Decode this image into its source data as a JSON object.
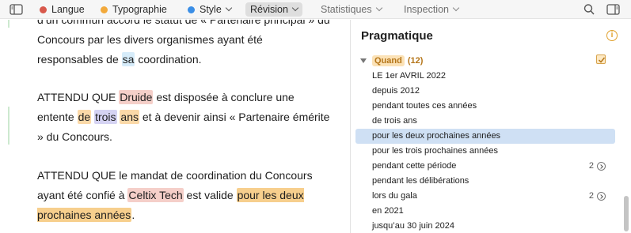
{
  "toolbar": {
    "items": [
      {
        "label": "Langue",
        "color": "#d8584b"
      },
      {
        "label": "Typographie",
        "color": "#f2a93b"
      },
      {
        "label": "Style",
        "color": "#3a8ee6"
      }
    ],
    "revision": "Révision",
    "statistics": "Statistiques",
    "inspection": "Inspection"
  },
  "editor": {
    "p1": {
      "line1": "d’un commun accord le statut de « Partenaire principal » du",
      "line2": "Concours par les divers organismes ayant été",
      "line3a": "responsables de ",
      "line3b": "sa",
      "line3c": " coordination."
    },
    "p2": {
      "a": "ATTENDU QUE ",
      "b": "Druide",
      "c": " est disposée à conclure une entente ",
      "d": "de",
      "e": "trois",
      "f": "ans",
      "g": " et à devenir ainsi « Partenaire émérite » du Concours."
    },
    "p3": {
      "a": "ATTENDU QUE le mandat de coordination du Concours ayant été confié à ",
      "b": "Celtix Tech",
      "c": " est valide ",
      "d": "pour les deux prochaines années",
      "e": "."
    }
  },
  "panel": {
    "title": "Pragmatique",
    "group_label": "Quand",
    "group_count": "(12)",
    "items": [
      {
        "text": "LE 1er AVRIL 2022",
        "badge": ""
      },
      {
        "text": "depuis 2012",
        "badge": ""
      },
      {
        "text": "pendant toutes ces années",
        "badge": ""
      },
      {
        "text": "de trois ans",
        "badge": ""
      },
      {
        "text": "pour les deux prochaines années",
        "badge": ""
      },
      {
        "text": "pour les trois prochaines années",
        "badge": ""
      },
      {
        "text": "pendant cette période",
        "badge": "2"
      },
      {
        "text": "pendant les délibérations",
        "badge": ""
      },
      {
        "text": "lors du gala",
        "badge": "2"
      },
      {
        "text": "en 2021",
        "badge": ""
      },
      {
        "text": "jusqu’au 30 juin 2024",
        "badge": ""
      }
    ],
    "selected_index": 4
  }
}
